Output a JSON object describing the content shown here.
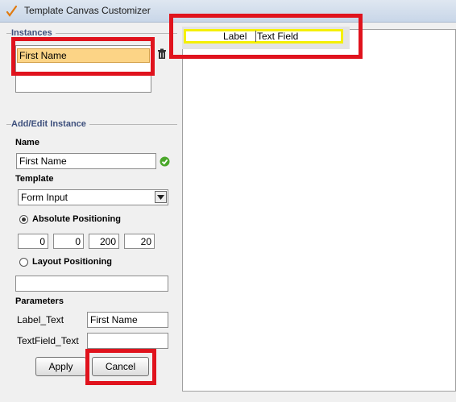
{
  "window": {
    "title": "Template Canvas Customizer"
  },
  "instances": {
    "section_title": "Instances",
    "items": [
      "First Name"
    ]
  },
  "add_edit": {
    "section_title": "Add/Edit Instance",
    "name_label": "Name",
    "name_value": "First Name",
    "template_label": "Template",
    "template_value": "Form Input",
    "absolute_label": "Absolute Positioning",
    "absolute_selected": true,
    "position_values": [
      "0",
      "0",
      "200",
      "20"
    ],
    "layout_label": "Layout Positioning",
    "layout_selected": false,
    "layout_value": "",
    "parameters_label": "Parameters",
    "params": [
      {
        "name": "Label_Text",
        "value": "First Name"
      },
      {
        "name": "TextField_Text",
        "value": ""
      }
    ]
  },
  "buttons": {
    "apply": "Apply",
    "cancel": "Cancel"
  },
  "canvas": {
    "chip_label": "Label",
    "chip_field": "Text Field"
  },
  "colors": {
    "highlight_red": "#e0131d",
    "chip_border": "#f5f000",
    "selection": "#fcd486",
    "valid_check": "#4aa72a"
  },
  "icons": [
    "edit-pencil-icon",
    "trash-icon",
    "checkmark-icon",
    "dropdown-arrow-icon"
  ]
}
